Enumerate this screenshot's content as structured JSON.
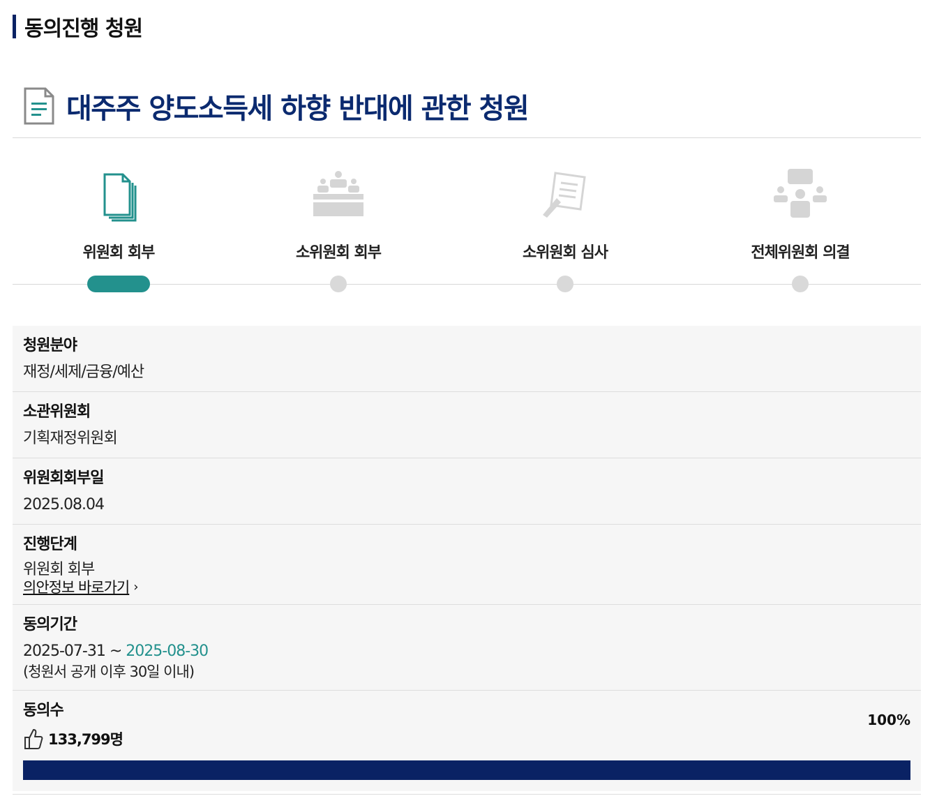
{
  "section_title": "동의진행 청원",
  "petition_title": "대주주 양도소득세 하향 반대에 관한 청원",
  "steps": [
    {
      "label": "위원회 회부",
      "active": true
    },
    {
      "label": "소위원회 회부",
      "active": false
    },
    {
      "label": "소위원회 심사",
      "active": false
    },
    {
      "label": "전체위원회 의결",
      "active": false
    }
  ],
  "info": {
    "field": {
      "label": "청원분야",
      "value": "재정/세제/금융/예산"
    },
    "committee": {
      "label": "소관위원회",
      "value": "기획재정위원회"
    },
    "referral_date": {
      "label": "위원회회부일",
      "value": "2025.08.04"
    },
    "stage": {
      "label": "진행단계",
      "value": "위원회 회부",
      "link": "의안정보 바로가기"
    },
    "period": {
      "label": "동의기간",
      "start": "2025-07-31",
      "separator": "~",
      "end": "2025-08-30",
      "note": "(청원서 공개 이후 30일 이내)"
    },
    "agree": {
      "label": "동의수",
      "count": "133,799명",
      "percent_text": "100%",
      "progress": 1.0
    }
  },
  "colors": {
    "accent": "#23918d",
    "brand": "#0a2264",
    "title": "#0b2a6f",
    "inactive": "#d9d9d9"
  },
  "icons": {
    "title": "document-icon",
    "steps": [
      "documents-stack-icon",
      "meeting-table-icon",
      "review-pen-icon",
      "assembly-vote-icon"
    ],
    "agree": "thumbs-up-icon",
    "link": "chevron-right-icon"
  }
}
